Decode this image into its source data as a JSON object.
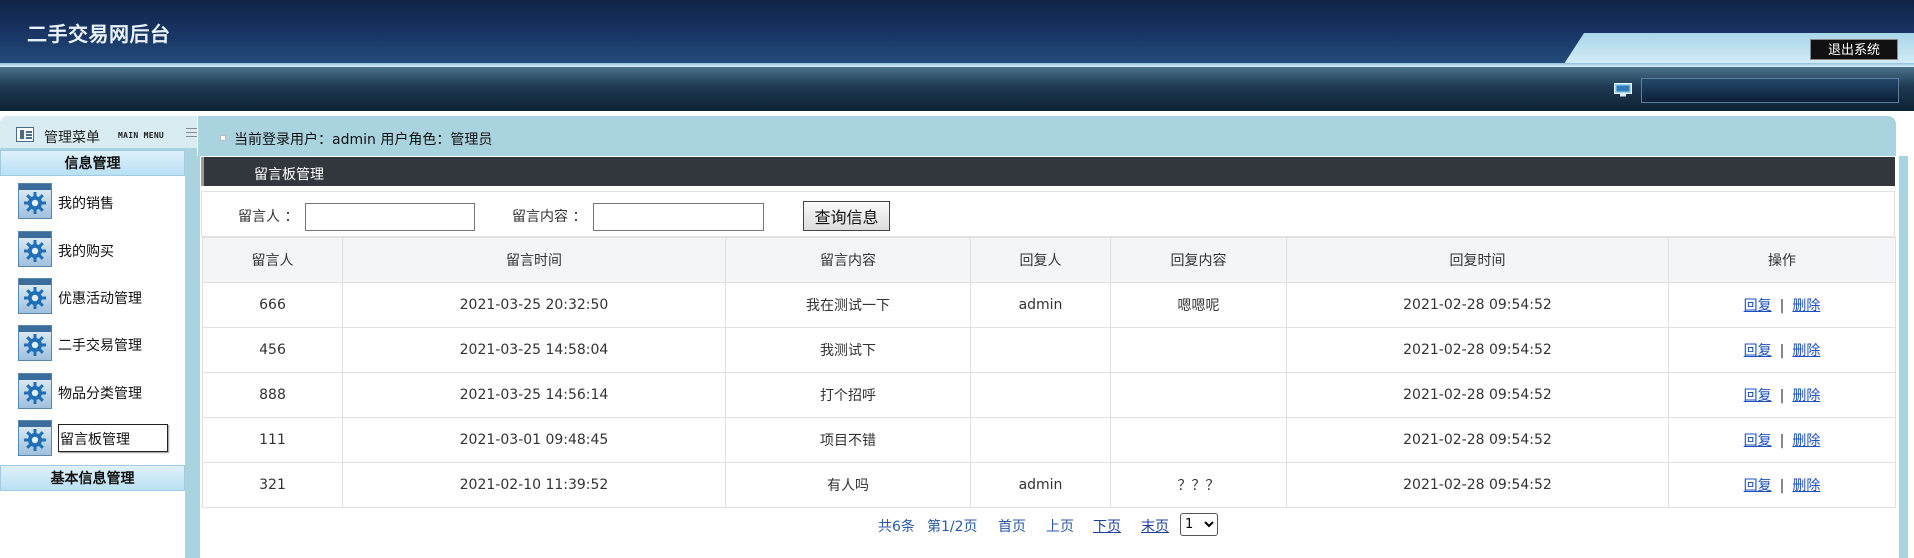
{
  "header": {
    "site_title": "二手交易网后台",
    "logout_label": "退出系统"
  },
  "menu": {
    "title": "管理菜单",
    "subtitle": "MAIN MENU",
    "groups": [
      {
        "label": "信息管理",
        "items": [
          {
            "label": "我的销售",
            "icon": "gear-icon"
          },
          {
            "label": "我的购买",
            "icon": "gear-icon"
          },
          {
            "label": "优惠活动管理",
            "icon": "gear-icon"
          },
          {
            "label": "二手交易管理",
            "icon": "gear-icon"
          },
          {
            "label": "物品分类管理",
            "icon": "gear-icon"
          },
          {
            "label": "留言板管理",
            "icon": "gear-icon",
            "active": true
          }
        ]
      },
      {
        "label": "基本信息管理",
        "items": []
      }
    ]
  },
  "userinfo": {
    "text": "当前登录用户：admin  用户角色：管理员"
  },
  "section": {
    "title": "留言板管理"
  },
  "search": {
    "author_label": "留言人 ：",
    "author_value": "",
    "content_label": "留言内容 ：",
    "content_value": "",
    "button_label": "查询信息"
  },
  "table": {
    "columns": [
      "留言人",
      "留言时间",
      "留言内容",
      "回复人",
      "回复内容",
      "回复时间",
      "操作"
    ],
    "rows": [
      {
        "author": "666",
        "time": "2021-03-25 20:32:50",
        "content": "我在测试一下",
        "replier": "admin",
        "reply": "嗯嗯呢",
        "reply_time": "2021-02-28 09:54:52"
      },
      {
        "author": "456",
        "time": "2021-03-25 14:58:04",
        "content": "我测试下",
        "replier": "",
        "reply": "",
        "reply_time": "2021-02-28 09:54:52"
      },
      {
        "author": "888",
        "time": "2021-03-25 14:56:14",
        "content": "打个招呼",
        "replier": "",
        "reply": "",
        "reply_time": "2021-02-28 09:54:52"
      },
      {
        "author": "111",
        "time": "2021-03-01 09:48:45",
        "content": "项目不错",
        "replier": "",
        "reply": "",
        "reply_time": "2021-02-28 09:54:52"
      },
      {
        "author": "321",
        "time": "2021-02-10 11:39:52",
        "content": "有人吗",
        "replier": "admin",
        "reply": "？？？",
        "reply_time": "2021-02-28 09:54:52"
      }
    ],
    "actions": {
      "reply": "回复",
      "separator": "|",
      "delete": "删除"
    }
  },
  "pager": {
    "total": "共6条",
    "page_info": "第1/2页",
    "first": "首页",
    "prev": "上页",
    "next": "下页",
    "last": "末页",
    "selected_page": "1"
  }
}
